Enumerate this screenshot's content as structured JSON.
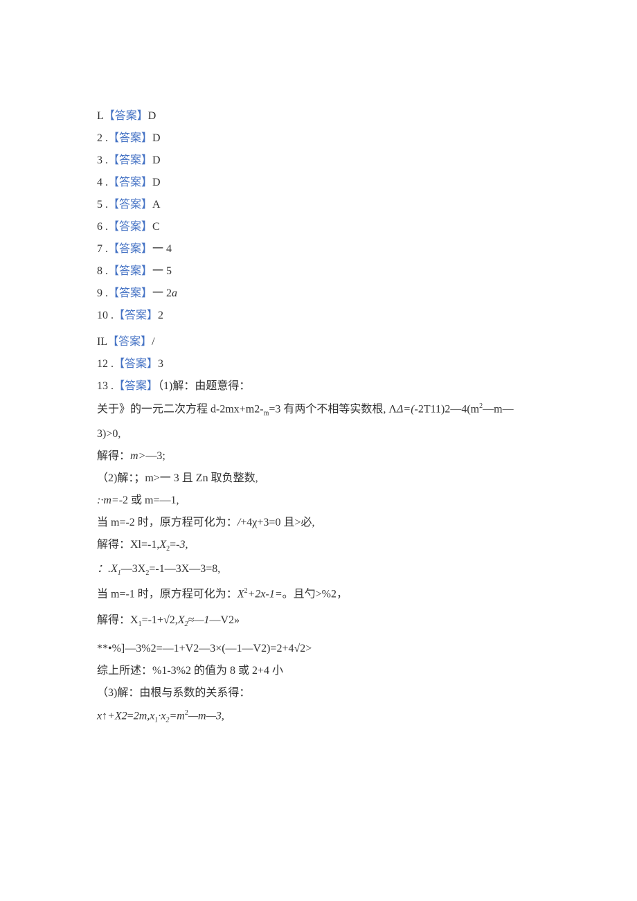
{
  "answers": [
    {
      "num": "L",
      "sep": "",
      "label": "【答案】",
      "val": "D"
    },
    {
      "num": "2",
      "sep": " .",
      "label": "【答案】",
      "val": "D"
    },
    {
      "num": "3",
      "sep": " .",
      "label": "【答案】",
      "val": "D"
    },
    {
      "num": "4",
      "sep": " .",
      "label": "【答案】",
      "val": "D"
    },
    {
      "num": "5",
      "sep": " .",
      "label": "【答案】",
      "val": "A"
    },
    {
      "num": "6",
      "sep": " .",
      "label": "【答案】",
      "val": "C"
    },
    {
      "num": "7",
      "sep": " .",
      "label": "【答案】",
      "val": "一 4"
    },
    {
      "num": "8",
      "sep": " .",
      "label": "【答案】",
      "val": "一 5"
    },
    {
      "num": "9",
      "sep": " .",
      "label": "【答案】",
      "val_prefix": "一 2",
      "val_italic": "a"
    },
    {
      "num": "10",
      "sep": "  .",
      "label": "【答案】",
      "val": "2"
    }
  ],
  "ans11": {
    "num": "IL",
    "label": "【答案】",
    "val": "/"
  },
  "ans12": {
    "num": "12  .",
    "label": "【答案】",
    "val": "3"
  },
  "ans13": {
    "num": "13  .",
    "label": "【答案】",
    "val": "（1)解：由题意得："
  },
  "line14": {
    "p1": "关于》的一元二次方程 d-2mx+m2-",
    "sub": "m",
    "p2": "=3 有两个不相等实数根, Λ",
    "it": "Δ=(",
    "p3": "-2T11)2—4(m",
    "sup": "2",
    "p4": "—m—"
  },
  "line15": "3)>0,",
  "line16": {
    "p1": "解得：",
    "it": "m>",
    "p2": "—3;"
  },
  "line17": "（2)解：；m>一 3 且 Zn 取负整数,",
  "line18": {
    "it1": ":·m=",
    "p1": "-2 或 m=—1,"
  },
  "line19": {
    "p1": "当 m=-2 时，原方程可化为：",
    "it": "/",
    "p2": "+4χ+3=0 且>必,"
  },
  "line20": {
    "p1": "解得：Xl=-1,",
    "it": "X",
    "sub": "2",
    "p2": "=-",
    "it2": "3,"
  },
  "line21": {
    "it": "：.X",
    "sub1": "1",
    "p1": "—3X",
    "sub2": "2",
    "p2": "=-1—3X—3=8,"
  },
  "line22": {
    "p1": "当 m=-1 时，原方程可化为：",
    "it": "X",
    "sup": "2",
    "it2": "+2x-1=",
    "p2": "。且勺>%2，"
  },
  "line23": {
    "p1": "解得：X",
    "sub1": "1",
    "p2": "=-1+√2,",
    "it": "X",
    "sub2": "2",
    "it2": "≈—1",
    "p3": "—V2»"
  },
  "line24": "**•%]—3%2=—1+V2—3×(—1—V2)=2+4√2>",
  "line25": "综上所述：%1-3%2 的值为 8 或 2+4 小",
  "line26": "（3)解：由根与系数的关系得：",
  "line27": {
    "it1": "x↑+X2",
    "p1": "=",
    "it2": "2m,x",
    "sub1": "1",
    "it3": "·x",
    "sub2": "2",
    "it4": "=m",
    "sup": "2",
    "it5": "—m—3,"
  }
}
